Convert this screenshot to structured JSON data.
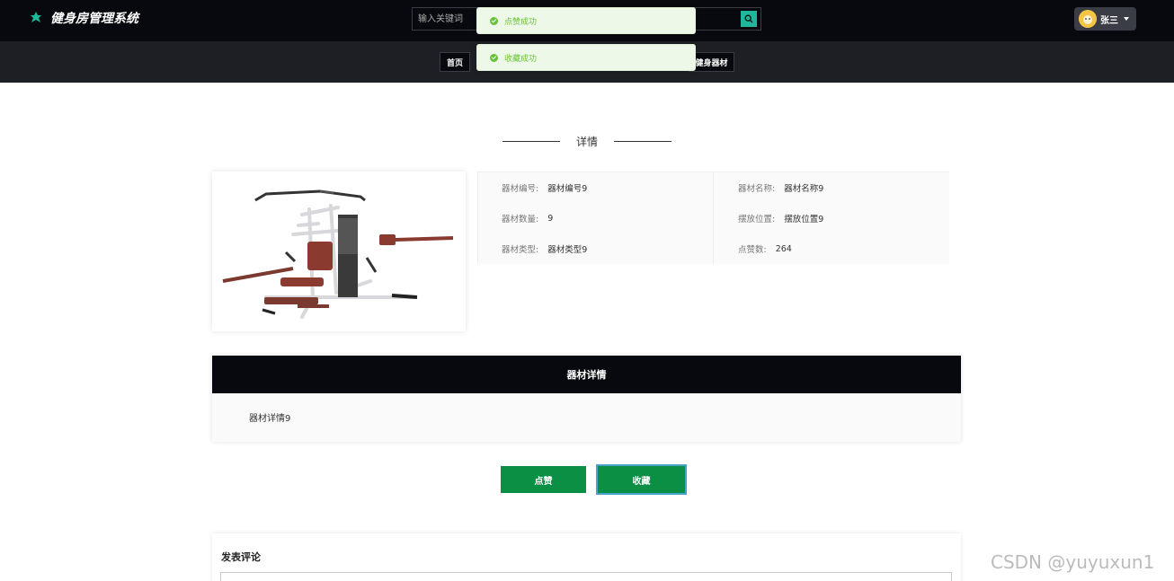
{
  "header": {
    "title": "健身房管理系统",
    "search_placeholder": "输入关键词",
    "user_name": "张三"
  },
  "nav": {
    "items": [
      {
        "label": "首页"
      },
      {
        "label": "健身器材"
      }
    ]
  },
  "toasts": [
    {
      "text": "点赞成功"
    },
    {
      "text": "收藏成功"
    }
  ],
  "section_title": "详情",
  "info": {
    "code_label": "器材编号:",
    "code_value": "器材编号9",
    "name_label": "器材名称:",
    "name_value": "器材名称9",
    "qty_label": "器材数量:",
    "qty_value": "9",
    "location_label": "摆放位置:",
    "location_value": "摆放位置9",
    "type_label": "器材类型:",
    "type_value": "器材类型9",
    "likes_label": "点赞数:",
    "likes_value": "264"
  },
  "detail": {
    "header": "器材详情",
    "body": "器材详情9"
  },
  "buttons": {
    "like": "点赞",
    "favorite": "收藏"
  },
  "comment": {
    "title": "发表评论"
  },
  "watermark": "CSDN @yuyuxun1",
  "colors": {
    "accent": "#1fb89a",
    "primary_button": "#0b8f45",
    "toast_success": "#67c23a",
    "header_bg": "#08090e"
  }
}
